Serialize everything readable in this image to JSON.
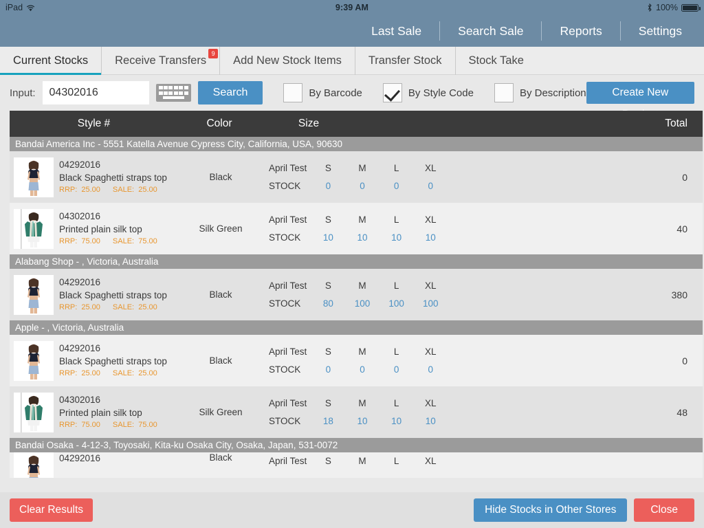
{
  "statusbar": {
    "device": "iPad",
    "wifi_icon": "wifi-icon",
    "time": "9:39 AM",
    "bluetooth_icon": "bluetooth-icon",
    "battery": "100%",
    "battery_icon": "battery-full-icon"
  },
  "topnav": {
    "items": [
      {
        "label": "Last Sale"
      },
      {
        "label": "Search Sale"
      },
      {
        "label": "Reports"
      },
      {
        "label": "Settings"
      }
    ]
  },
  "tabs": [
    {
      "label": "Current Stocks",
      "active": true,
      "badge": null
    },
    {
      "label": "Receive Transfers",
      "active": false,
      "badge": "9"
    },
    {
      "label": "Add New Stock Items",
      "active": false,
      "badge": null
    },
    {
      "label": "Transfer Stock",
      "active": false,
      "badge": null
    },
    {
      "label": "Stock Take",
      "active": false,
      "badge": null
    }
  ],
  "searchbar": {
    "input_label": "Input:",
    "input_value": "04302016",
    "input_placeholder": "",
    "keyboard_icon": "keyboard-icon",
    "search_label": "Search",
    "filters": [
      {
        "label": "By Barcode",
        "checked": false
      },
      {
        "label": "By Style Code",
        "checked": true
      },
      {
        "label": "By Description",
        "checked": false
      }
    ],
    "create_label": "Create New Product"
  },
  "table": {
    "headers": {
      "style": "Style #",
      "color": "Color",
      "size": "Size",
      "total": "Total"
    },
    "size_label": "April Test",
    "stock_label": "STOCK",
    "size_columns": [
      "S",
      "M",
      "L",
      "XL"
    ],
    "rrp_label": "RRP:",
    "sale_label": "SALE:",
    "groups": [
      {
        "header": "Bandai America Inc - 5551 Katella Avenue Cypress City, California, USA, 90630",
        "rows": [
          {
            "style": "04292016",
            "desc": "Black Spaghetti straps top",
            "rrp": "25.00",
            "sale": "25.00",
            "color": "Black",
            "thumb": "black-top-thumb",
            "stock": [
              "0",
              "0",
              "0",
              "0"
            ],
            "total": "0"
          },
          {
            "style": "04302016",
            "desc": "Printed plain silk top",
            "rrp": "75.00",
            "sale": "75.00",
            "color": "Silk Green",
            "thumb": "silk-green-top-thumb",
            "stock": [
              "10",
              "10",
              "10",
              "10"
            ],
            "total": "40"
          }
        ]
      },
      {
        "header": "Alabang Shop - , Victoria, Australia",
        "rows": [
          {
            "style": "04292016",
            "desc": "Black Spaghetti straps top",
            "rrp": "25.00",
            "sale": "25.00",
            "color": "Black",
            "thumb": "black-top-thumb",
            "stock": [
              "80",
              "100",
              "100",
              "100"
            ],
            "total": "380"
          }
        ]
      },
      {
        "header": "Apple - , Victoria, Australia",
        "rows": [
          {
            "style": "04292016",
            "desc": "Black Spaghetti straps top",
            "rrp": "25.00",
            "sale": "25.00",
            "color": "Black",
            "thumb": "black-top-thumb",
            "stock": [
              "0",
              "0",
              "0",
              "0"
            ],
            "total": "0"
          },
          {
            "style": "04302016",
            "desc": "Printed plain silk top",
            "rrp": "75.00",
            "sale": "75.00",
            "color": "Silk Green",
            "thumb": "silk-green-top-thumb",
            "stock": [
              "18",
              "10",
              "10",
              "10"
            ],
            "total": "48"
          }
        ]
      },
      {
        "header": "Bandai Osaka - 4-12-3, Toyosaki, Kita-ku Osaka City, Osaka, Japan, 531-0072",
        "rows": [
          {
            "style": "04292016",
            "desc": "",
            "rrp": "",
            "sale": "",
            "color": "Black",
            "thumb": "black-top-thumb",
            "stock": [
              "",
              "",
              "",
              ""
            ],
            "total": "",
            "partial": true
          }
        ]
      }
    ]
  },
  "actionbar": {
    "clear_label": "Clear Results",
    "hide_label": "Hide Stocks in Other Stores",
    "close_label": "Close"
  },
  "colors": {
    "nav_blue": "#6d8ba4",
    "accent_teal": "#17a2bd",
    "button_blue": "#4a90c4",
    "button_red": "#ec5f5b",
    "badge_red": "#e8463f",
    "price_orange": "#e8962e",
    "group_gray": "#9b9b9b",
    "header_dark": "#3b3b3b",
    "stock_value_blue": "#4a90c4"
  }
}
